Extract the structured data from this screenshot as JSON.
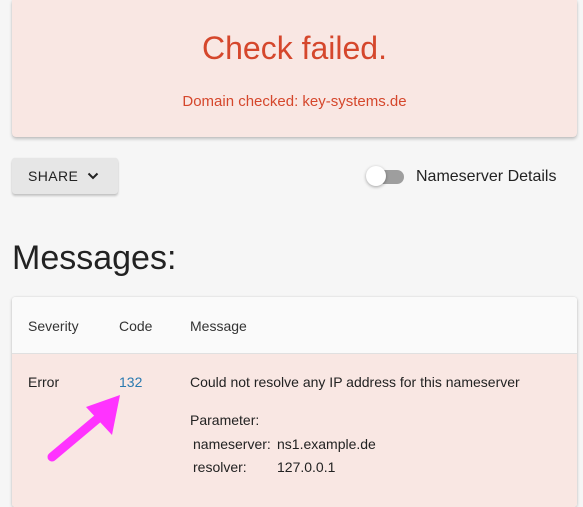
{
  "banner": {
    "title": "Check failed.",
    "subtitle": "Domain checked: key-systems.de"
  },
  "toolbar": {
    "share_label": "SHARE",
    "toggle_label": "Nameserver Details",
    "toggle_on": false
  },
  "messages": {
    "heading": "Messages:",
    "columns": [
      "Severity",
      "Code",
      "Message"
    ],
    "rows": [
      {
        "severity": "Error",
        "code": "132",
        "message": "Could not resolve any IP address for this nameserver",
        "parameter_label": "Parameter:",
        "params": [
          {
            "key": "nameserver:",
            "value": "ns1.example.de"
          },
          {
            "key": "resolver:",
            "value": "127.0.0.1"
          }
        ]
      }
    ]
  },
  "colors": {
    "error_text": "#d5472c",
    "error_bg": "#f9e7e3",
    "link": "#2a7ab0",
    "annotation_arrow": "#ff33ff"
  }
}
